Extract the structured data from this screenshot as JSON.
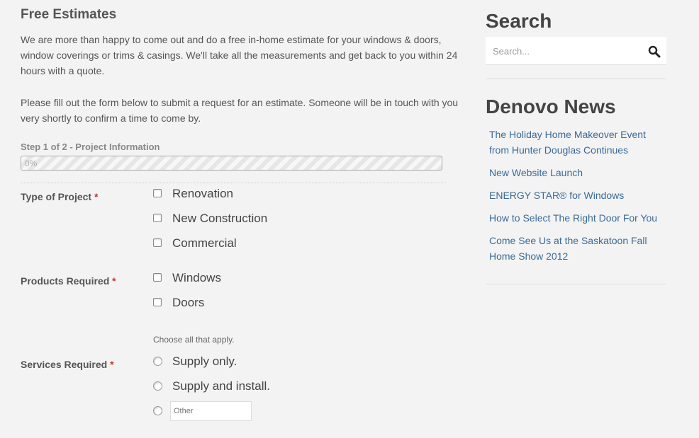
{
  "main": {
    "title": "Free Estimates",
    "intro": "We are more than happy to come out and do a free in-home estimate for your windows & doors, window coverings or trims & casings. We'll take all the measurements and get back to you within 24 hours with a quote.",
    "instructions": "Please fill out the form below to submit a request for an estimate. Someone will be in touch with you very shortly to confirm a time to come by.",
    "step_label": "Step 1 of 2 - Project Information",
    "progress": {
      "percent": 0,
      "text": "0%"
    },
    "required_marker": "*",
    "type_of_project": {
      "label": "Type of Project",
      "options": [
        "Renovation",
        "New Construction",
        "Commercial"
      ]
    },
    "products_required": {
      "label": "Products Required",
      "options": [
        "Windows",
        "Doors"
      ],
      "hint": "Choose all that apply."
    },
    "services_required": {
      "label": "Services Required",
      "options": [
        "Supply only.",
        "Supply and install."
      ],
      "other_placeholder": "Other"
    }
  },
  "sidebar": {
    "search_title": "Search",
    "search_placeholder": "Search...",
    "news_title": "Denovo News",
    "news_items": [
      "The Holiday Home Makeover Event from Hunter Douglas Continues",
      "New Website Launch",
      "ENERGY STAR® for Windows",
      "How to Select The Right Door For You",
      "Come See Us at the Saskatoon Fall Home Show 2012"
    ]
  },
  "colors": {
    "background": "#f3f3f3",
    "link": "#3b6a96",
    "required": "#c0392b"
  },
  "icons": {
    "search": "magnifier-icon"
  }
}
